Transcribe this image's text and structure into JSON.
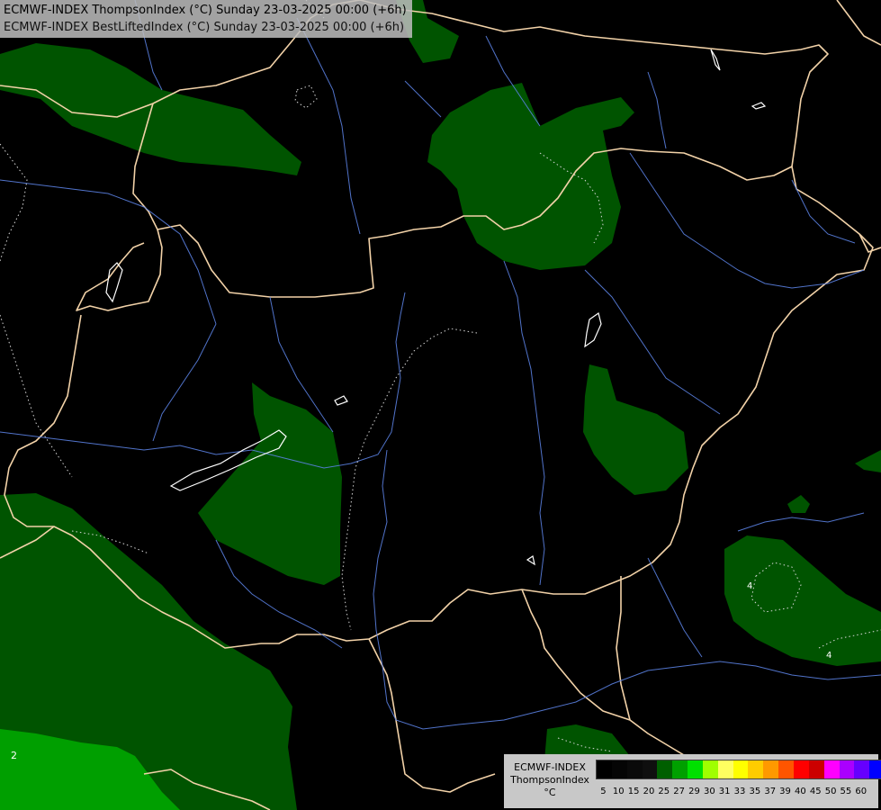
{
  "header": {
    "line1": "ECMWF-INDEX ThompsonIndex (°C) Sunday 23-03-2025 00:00 (+6h)",
    "line2": "ECMWF-INDEX BestLiftedIndex (°C) Sunday 23-03-2025 00:00 (+6h)"
  },
  "legend": {
    "model": "ECMWF-INDEX",
    "parameter": "ThompsonIndex",
    "unit": "°C",
    "ticks": [
      "5",
      "10",
      "15",
      "20",
      "25",
      "27",
      "29",
      "30",
      "31",
      "33",
      "35",
      "37",
      "39",
      "40",
      "45",
      "50",
      "55",
      "60"
    ],
    "colors": [
      "#000000",
      "#050505",
      "#0a0a0a",
      "#0f0f0f",
      "#005f00",
      "#00a000",
      "#00e000",
      "#a0ff00",
      "#ffff60",
      "#ffff00",
      "#ffcc00",
      "#ff9900",
      "#ff5500",
      "#ff0000",
      "#cc0000",
      "#ff00ff",
      "#aa00ff",
      "#6600ff",
      "#0000ff"
    ]
  },
  "map_labels": {
    "isoline_2": "2",
    "isoline_4_east": "4",
    "isoline_4_southeast": "4"
  },
  "colors": {
    "background": "#000000",
    "field_dark_green": "#005400",
    "field_green": "#009f00",
    "border": "#f2d2a8",
    "river": "#5a80e0",
    "isoline": "#d8d8d8"
  }
}
